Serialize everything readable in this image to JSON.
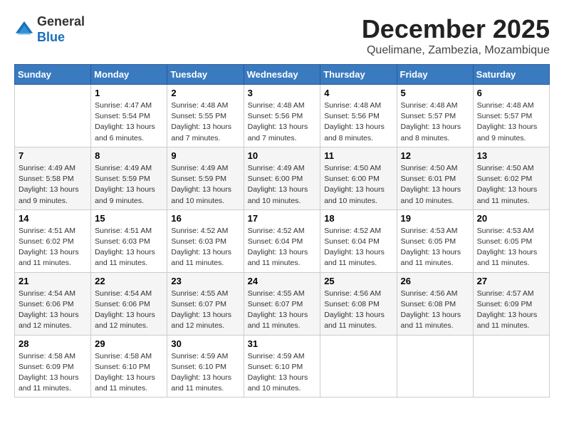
{
  "logo": {
    "general": "General",
    "blue": "Blue"
  },
  "header": {
    "month": "December 2025",
    "location": "Quelimane, Zambezia, Mozambique"
  },
  "days_of_week": [
    "Sunday",
    "Monday",
    "Tuesday",
    "Wednesday",
    "Thursday",
    "Friday",
    "Saturday"
  ],
  "weeks": [
    [
      {
        "day": "",
        "info": ""
      },
      {
        "day": "1",
        "info": "Sunrise: 4:47 AM\nSunset: 5:54 PM\nDaylight: 13 hours\nand 6 minutes."
      },
      {
        "day": "2",
        "info": "Sunrise: 4:48 AM\nSunset: 5:55 PM\nDaylight: 13 hours\nand 7 minutes."
      },
      {
        "day": "3",
        "info": "Sunrise: 4:48 AM\nSunset: 5:56 PM\nDaylight: 13 hours\nand 7 minutes."
      },
      {
        "day": "4",
        "info": "Sunrise: 4:48 AM\nSunset: 5:56 PM\nDaylight: 13 hours\nand 8 minutes."
      },
      {
        "day": "5",
        "info": "Sunrise: 4:48 AM\nSunset: 5:57 PM\nDaylight: 13 hours\nand 8 minutes."
      },
      {
        "day": "6",
        "info": "Sunrise: 4:48 AM\nSunset: 5:57 PM\nDaylight: 13 hours\nand 9 minutes."
      }
    ],
    [
      {
        "day": "7",
        "info": "Sunrise: 4:49 AM\nSunset: 5:58 PM\nDaylight: 13 hours\nand 9 minutes."
      },
      {
        "day": "8",
        "info": "Sunrise: 4:49 AM\nSunset: 5:59 PM\nDaylight: 13 hours\nand 9 minutes."
      },
      {
        "day": "9",
        "info": "Sunrise: 4:49 AM\nSunset: 5:59 PM\nDaylight: 13 hours\nand 10 minutes."
      },
      {
        "day": "10",
        "info": "Sunrise: 4:49 AM\nSunset: 6:00 PM\nDaylight: 13 hours\nand 10 minutes."
      },
      {
        "day": "11",
        "info": "Sunrise: 4:50 AM\nSunset: 6:00 PM\nDaylight: 13 hours\nand 10 minutes."
      },
      {
        "day": "12",
        "info": "Sunrise: 4:50 AM\nSunset: 6:01 PM\nDaylight: 13 hours\nand 10 minutes."
      },
      {
        "day": "13",
        "info": "Sunrise: 4:50 AM\nSunset: 6:02 PM\nDaylight: 13 hours\nand 11 minutes."
      }
    ],
    [
      {
        "day": "14",
        "info": "Sunrise: 4:51 AM\nSunset: 6:02 PM\nDaylight: 13 hours\nand 11 minutes."
      },
      {
        "day": "15",
        "info": "Sunrise: 4:51 AM\nSunset: 6:03 PM\nDaylight: 13 hours\nand 11 minutes."
      },
      {
        "day": "16",
        "info": "Sunrise: 4:52 AM\nSunset: 6:03 PM\nDaylight: 13 hours\nand 11 minutes."
      },
      {
        "day": "17",
        "info": "Sunrise: 4:52 AM\nSunset: 6:04 PM\nDaylight: 13 hours\nand 11 minutes."
      },
      {
        "day": "18",
        "info": "Sunrise: 4:52 AM\nSunset: 6:04 PM\nDaylight: 13 hours\nand 11 minutes."
      },
      {
        "day": "19",
        "info": "Sunrise: 4:53 AM\nSunset: 6:05 PM\nDaylight: 13 hours\nand 11 minutes."
      },
      {
        "day": "20",
        "info": "Sunrise: 4:53 AM\nSunset: 6:05 PM\nDaylight: 13 hours\nand 11 minutes."
      }
    ],
    [
      {
        "day": "21",
        "info": "Sunrise: 4:54 AM\nSunset: 6:06 PM\nDaylight: 13 hours\nand 12 minutes."
      },
      {
        "day": "22",
        "info": "Sunrise: 4:54 AM\nSunset: 6:06 PM\nDaylight: 13 hours\nand 12 minutes."
      },
      {
        "day": "23",
        "info": "Sunrise: 4:55 AM\nSunset: 6:07 PM\nDaylight: 13 hours\nand 12 minutes."
      },
      {
        "day": "24",
        "info": "Sunrise: 4:55 AM\nSunset: 6:07 PM\nDaylight: 13 hours\nand 11 minutes."
      },
      {
        "day": "25",
        "info": "Sunrise: 4:56 AM\nSunset: 6:08 PM\nDaylight: 13 hours\nand 11 minutes."
      },
      {
        "day": "26",
        "info": "Sunrise: 4:56 AM\nSunset: 6:08 PM\nDaylight: 13 hours\nand 11 minutes."
      },
      {
        "day": "27",
        "info": "Sunrise: 4:57 AM\nSunset: 6:09 PM\nDaylight: 13 hours\nand 11 minutes."
      }
    ],
    [
      {
        "day": "28",
        "info": "Sunrise: 4:58 AM\nSunset: 6:09 PM\nDaylight: 13 hours\nand 11 minutes."
      },
      {
        "day": "29",
        "info": "Sunrise: 4:58 AM\nSunset: 6:10 PM\nDaylight: 13 hours\nand 11 minutes."
      },
      {
        "day": "30",
        "info": "Sunrise: 4:59 AM\nSunset: 6:10 PM\nDaylight: 13 hours\nand 11 minutes."
      },
      {
        "day": "31",
        "info": "Sunrise: 4:59 AM\nSunset: 6:10 PM\nDaylight: 13 hours\nand 10 minutes."
      },
      {
        "day": "",
        "info": ""
      },
      {
        "day": "",
        "info": ""
      },
      {
        "day": "",
        "info": ""
      }
    ]
  ]
}
